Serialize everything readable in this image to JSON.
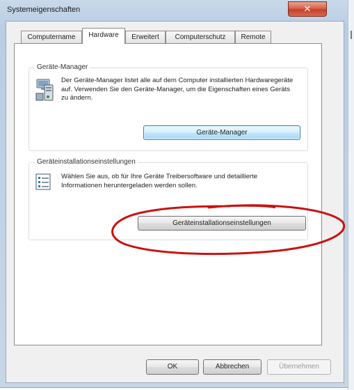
{
  "window": {
    "title": "Systemeigenschaften"
  },
  "tabs": [
    {
      "label": "Computername"
    },
    {
      "label": "Hardware"
    },
    {
      "label": "Erweitert"
    },
    {
      "label": "Computerschutz"
    },
    {
      "label": "Remote"
    }
  ],
  "device_manager": {
    "group_label": "Geräte-Manager",
    "description": "Der Geräte-Manager listet alle auf dem Computer installierten Hardwaregeräte auf. Verwenden Sie den Geräte-Manager, um die Eigenschaften eines Geräts zu ändern.",
    "button_label": "Geräte-Manager",
    "icon": "computer-device-manager-icon"
  },
  "device_installation": {
    "group_label": "Geräteinstallationseinstellungen",
    "description": "Wählen Sie aus, ob für Ihre Geräte Treibersoftware und detaillierte Informationen heruntergeladen werden sollen.",
    "button_label": "Geräteinstallationseinstellungen",
    "icon": "checklist-settings-icon"
  },
  "footer": {
    "ok_label": "OK",
    "cancel_label": "Abbrechen",
    "apply_label": "Übernehmen"
  },
  "annotation": {
    "color": "#cc1111",
    "shape": "hand-drawn-ellipse"
  }
}
